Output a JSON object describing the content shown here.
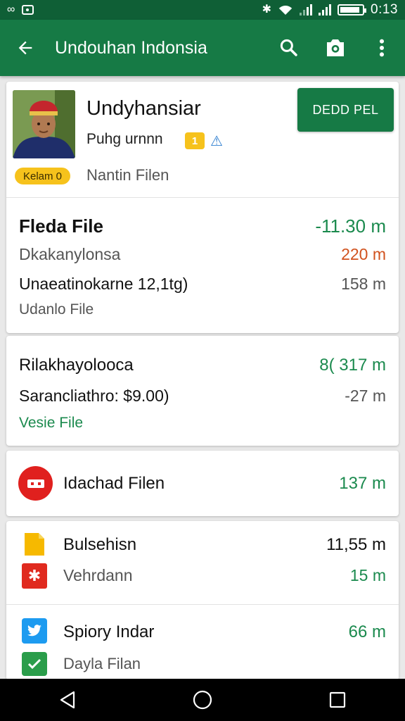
{
  "status_bar": {
    "left_glyph": "∞",
    "time": "0:13",
    "battery_level": 0.9
  },
  "app_bar": {
    "title": "Undouhan Indonsia",
    "back_icon": "arrow-left-icon",
    "actions": [
      "search-icon",
      "camera-icon",
      "more-vert-icon"
    ]
  },
  "profile": {
    "name": "Undyhansiar",
    "subtitle": "Puhg urnnn",
    "badge": "1",
    "warn_glyph": "⚠",
    "pill": "Kelam 0",
    "caption": "Nantin Filen",
    "primary_button": "DEDD PEL"
  },
  "summary": {
    "rows": [
      {
        "label": "Fleda File",
        "value": "-11.30 m"
      },
      {
        "label": "Dkakanylonsa",
        "value": "220 m"
      },
      {
        "label": "Unaeatinokarne 12,1tg)",
        "value": "158 m"
      },
      {
        "label": "Udanlo File",
        "value": ""
      }
    ]
  },
  "card2": {
    "rows": [
      {
        "label": "Rilakhayolooca",
        "value": "8( 317 m"
      },
      {
        "label": "Sarancliathro: $9.00)",
        "value": "-27 m"
      },
      {
        "label": "Vesie File",
        "value": ""
      }
    ]
  },
  "card3": {
    "icon": "download-badge-icon",
    "label": "Idachad Filen",
    "value": "137 m"
  },
  "card4": {
    "items": [
      {
        "icon": "file-icon",
        "label": "Bulsehisn",
        "value": "11,55 m"
      },
      {
        "icon": "star-badge-icon",
        "label": "Vehrdann",
        "value": "15 m"
      },
      {
        "icon": "twitter-bird-icon",
        "label": "Spiory Indar",
        "value": "66 m"
      },
      {
        "icon": "check-badge-icon",
        "label": "Dayla Filan",
        "value": ""
      }
    ]
  },
  "colors": {
    "primary": "#167a45",
    "status": "#0f5f36",
    "positive": "#1b8a4e",
    "negative": "#d1521e",
    "accent_yellow": "#f6c21c"
  }
}
